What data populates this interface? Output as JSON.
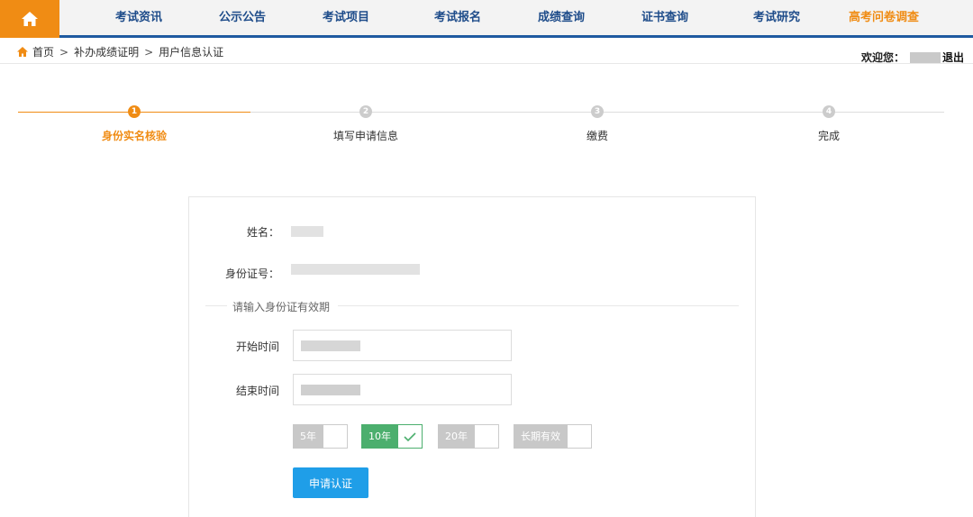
{
  "nav": {
    "items": [
      {
        "label": "考试资讯"
      },
      {
        "label": "公示公告"
      },
      {
        "label": "考试项目"
      },
      {
        "label": "考试报名"
      },
      {
        "label": "成绩查询"
      },
      {
        "label": "证书查询"
      },
      {
        "label": "考试研究"
      },
      {
        "label": "高考问卷调查"
      }
    ],
    "highlight_color": "#f08c14",
    "text_color": "#1e4c8a"
  },
  "breadcrumb": {
    "items": [
      "首页",
      "补办成绩证明",
      "用户信息认证"
    ],
    "separator": ">"
  },
  "user": {
    "welcome_label": "欢迎您：",
    "logout_label": "退出"
  },
  "steps": {
    "items": [
      {
        "number": "1",
        "label": "身份实名核验"
      },
      {
        "number": "2",
        "label": "填写申请信息"
      },
      {
        "number": "3",
        "label": "缴费"
      },
      {
        "number": "4",
        "label": "完成"
      }
    ],
    "active_index": 0,
    "active_color": "#f08c14"
  },
  "form": {
    "name_label": "姓名：",
    "id_label": "身份证号：",
    "section_legend": "请输入身份证有效期",
    "start_label": "开始时间",
    "end_label": "结束时间",
    "periods": [
      {
        "label": "5年",
        "selected": false
      },
      {
        "label": "10年",
        "selected": true
      },
      {
        "label": "20年",
        "selected": false
      },
      {
        "label": "长期有效",
        "selected": false
      }
    ],
    "submit_label": "申请认证",
    "submit_color": "#1f9ee8",
    "selected_color": "#4caf6e"
  }
}
